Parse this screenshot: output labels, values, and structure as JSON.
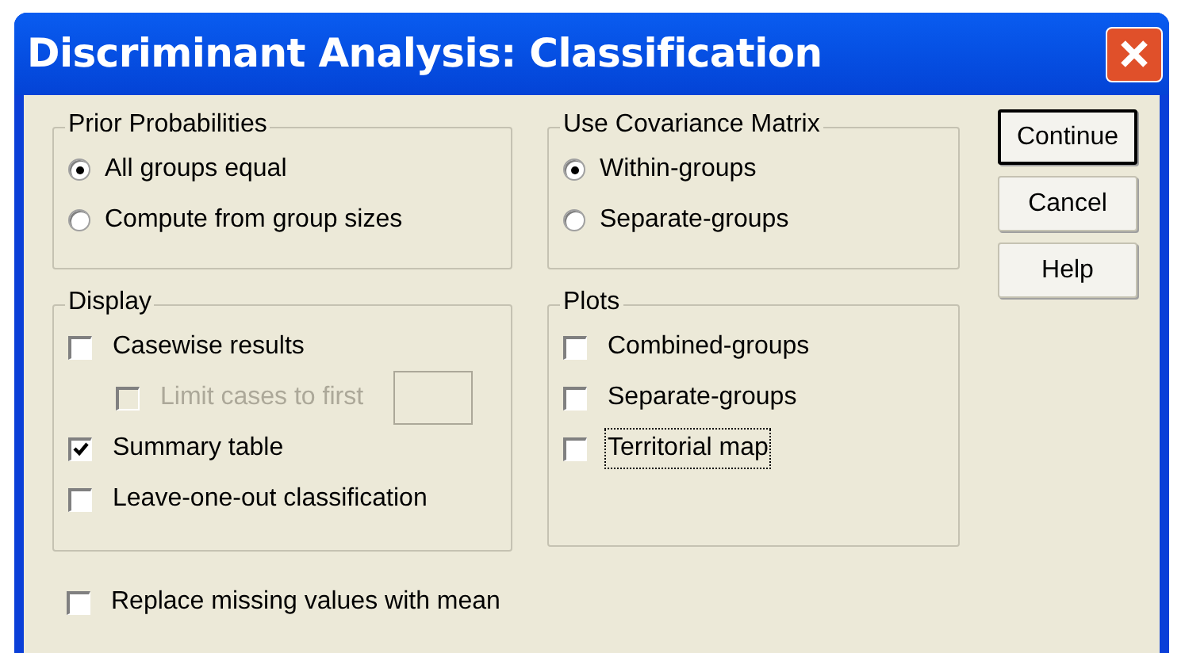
{
  "window": {
    "title": "Discriminant Analysis: Classification"
  },
  "groups": [
    {
      "title": "Prior Probabilities",
      "kind": "radio",
      "items": [
        {
          "label": "All groups equal",
          "selected": true
        },
        {
          "label": "Compute from group sizes",
          "selected": false
        }
      ]
    },
    {
      "title": "Use Covariance Matrix",
      "kind": "radio",
      "items": [
        {
          "label": "Within-groups",
          "selected": true
        },
        {
          "label": "Separate-groups",
          "selected": false
        }
      ]
    },
    {
      "title": "Display",
      "kind": "check",
      "items": [
        {
          "label": "Casewise results",
          "checked": false
        },
        {
          "label": "Limit cases to first",
          "checked": false,
          "disabled": true,
          "indented": true,
          "has_field": true
        },
        {
          "label": "Summary table",
          "checked": true
        },
        {
          "label": "Leave-one-out classification",
          "checked": false
        }
      ]
    },
    {
      "title": "Plots",
      "kind": "check",
      "items": [
        {
          "label": "Combined-groups",
          "checked": false
        },
        {
          "label": "Separate-groups",
          "checked": false
        },
        {
          "label": "Territorial map",
          "checked": false,
          "focused": true
        }
      ]
    }
  ],
  "buttons": [
    {
      "label": "Continue",
      "default": true
    },
    {
      "label": "Cancel",
      "default": false
    },
    {
      "label": "Help",
      "default": false
    }
  ],
  "replace_missing": {
    "label": "Replace missing values with mean",
    "checked": false
  }
}
